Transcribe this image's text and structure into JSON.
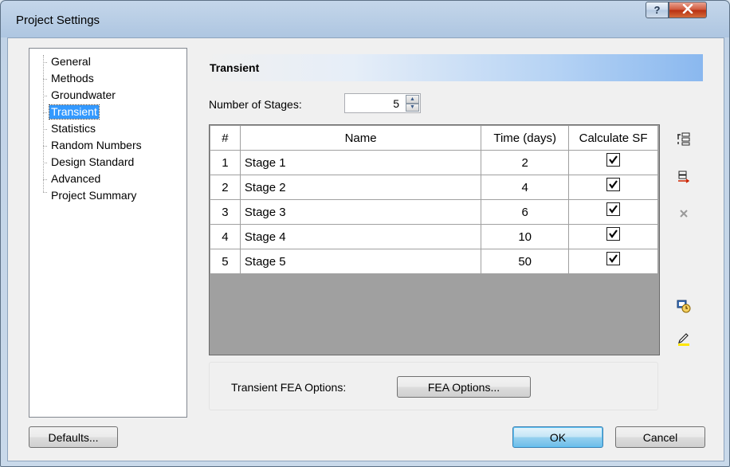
{
  "window": {
    "title": "Project Settings",
    "help_glyph": "?",
    "close_glyph": "X"
  },
  "tree": {
    "items": [
      {
        "label": "General",
        "selected": false
      },
      {
        "label": "Methods",
        "selected": false
      },
      {
        "label": "Groundwater",
        "selected": false
      },
      {
        "label": "Transient",
        "selected": true
      },
      {
        "label": "Statistics",
        "selected": false
      },
      {
        "label": "Random Numbers",
        "selected": false
      },
      {
        "label": "Design Standard",
        "selected": false
      },
      {
        "label": "Advanced",
        "selected": false
      },
      {
        "label": "Project Summary",
        "selected": false
      }
    ]
  },
  "section": {
    "title": "Transient"
  },
  "stages": {
    "label": "Number of Stages:",
    "value": "5"
  },
  "grid": {
    "headers": [
      "#",
      "Name",
      "Time (days)",
      "Calculate SF"
    ],
    "rows": [
      {
        "num": "1",
        "name": "Stage 1",
        "time": "2",
        "calc_sf": true
      },
      {
        "num": "2",
        "name": "Stage 2",
        "time": "4",
        "calc_sf": true
      },
      {
        "num": "3",
        "name": "Stage 3",
        "time": "6",
        "calc_sf": true
      },
      {
        "num": "4",
        "name": "Stage 4",
        "time": "10",
        "calc_sf": true
      },
      {
        "num": "5",
        "name": "Stage 5",
        "time": "50",
        "calc_sf": true
      }
    ]
  },
  "side_icons": {
    "insert_row": "insert-row-icon",
    "add_row": "add-row-icon",
    "delete_row": "delete-row-icon",
    "time_settings": "time-settings-icon",
    "edit": "edit-pencil-icon"
  },
  "fea": {
    "label": "Transient FEA Options:",
    "button_label": "FEA Options..."
  },
  "buttons": {
    "defaults": "Defaults...",
    "ok": "OK",
    "cancel": "Cancel"
  },
  "colors": {
    "selection": "#3399ff",
    "header_gradient_end": "#8ab8ef",
    "grid_empty": "#a0a0a0"
  }
}
